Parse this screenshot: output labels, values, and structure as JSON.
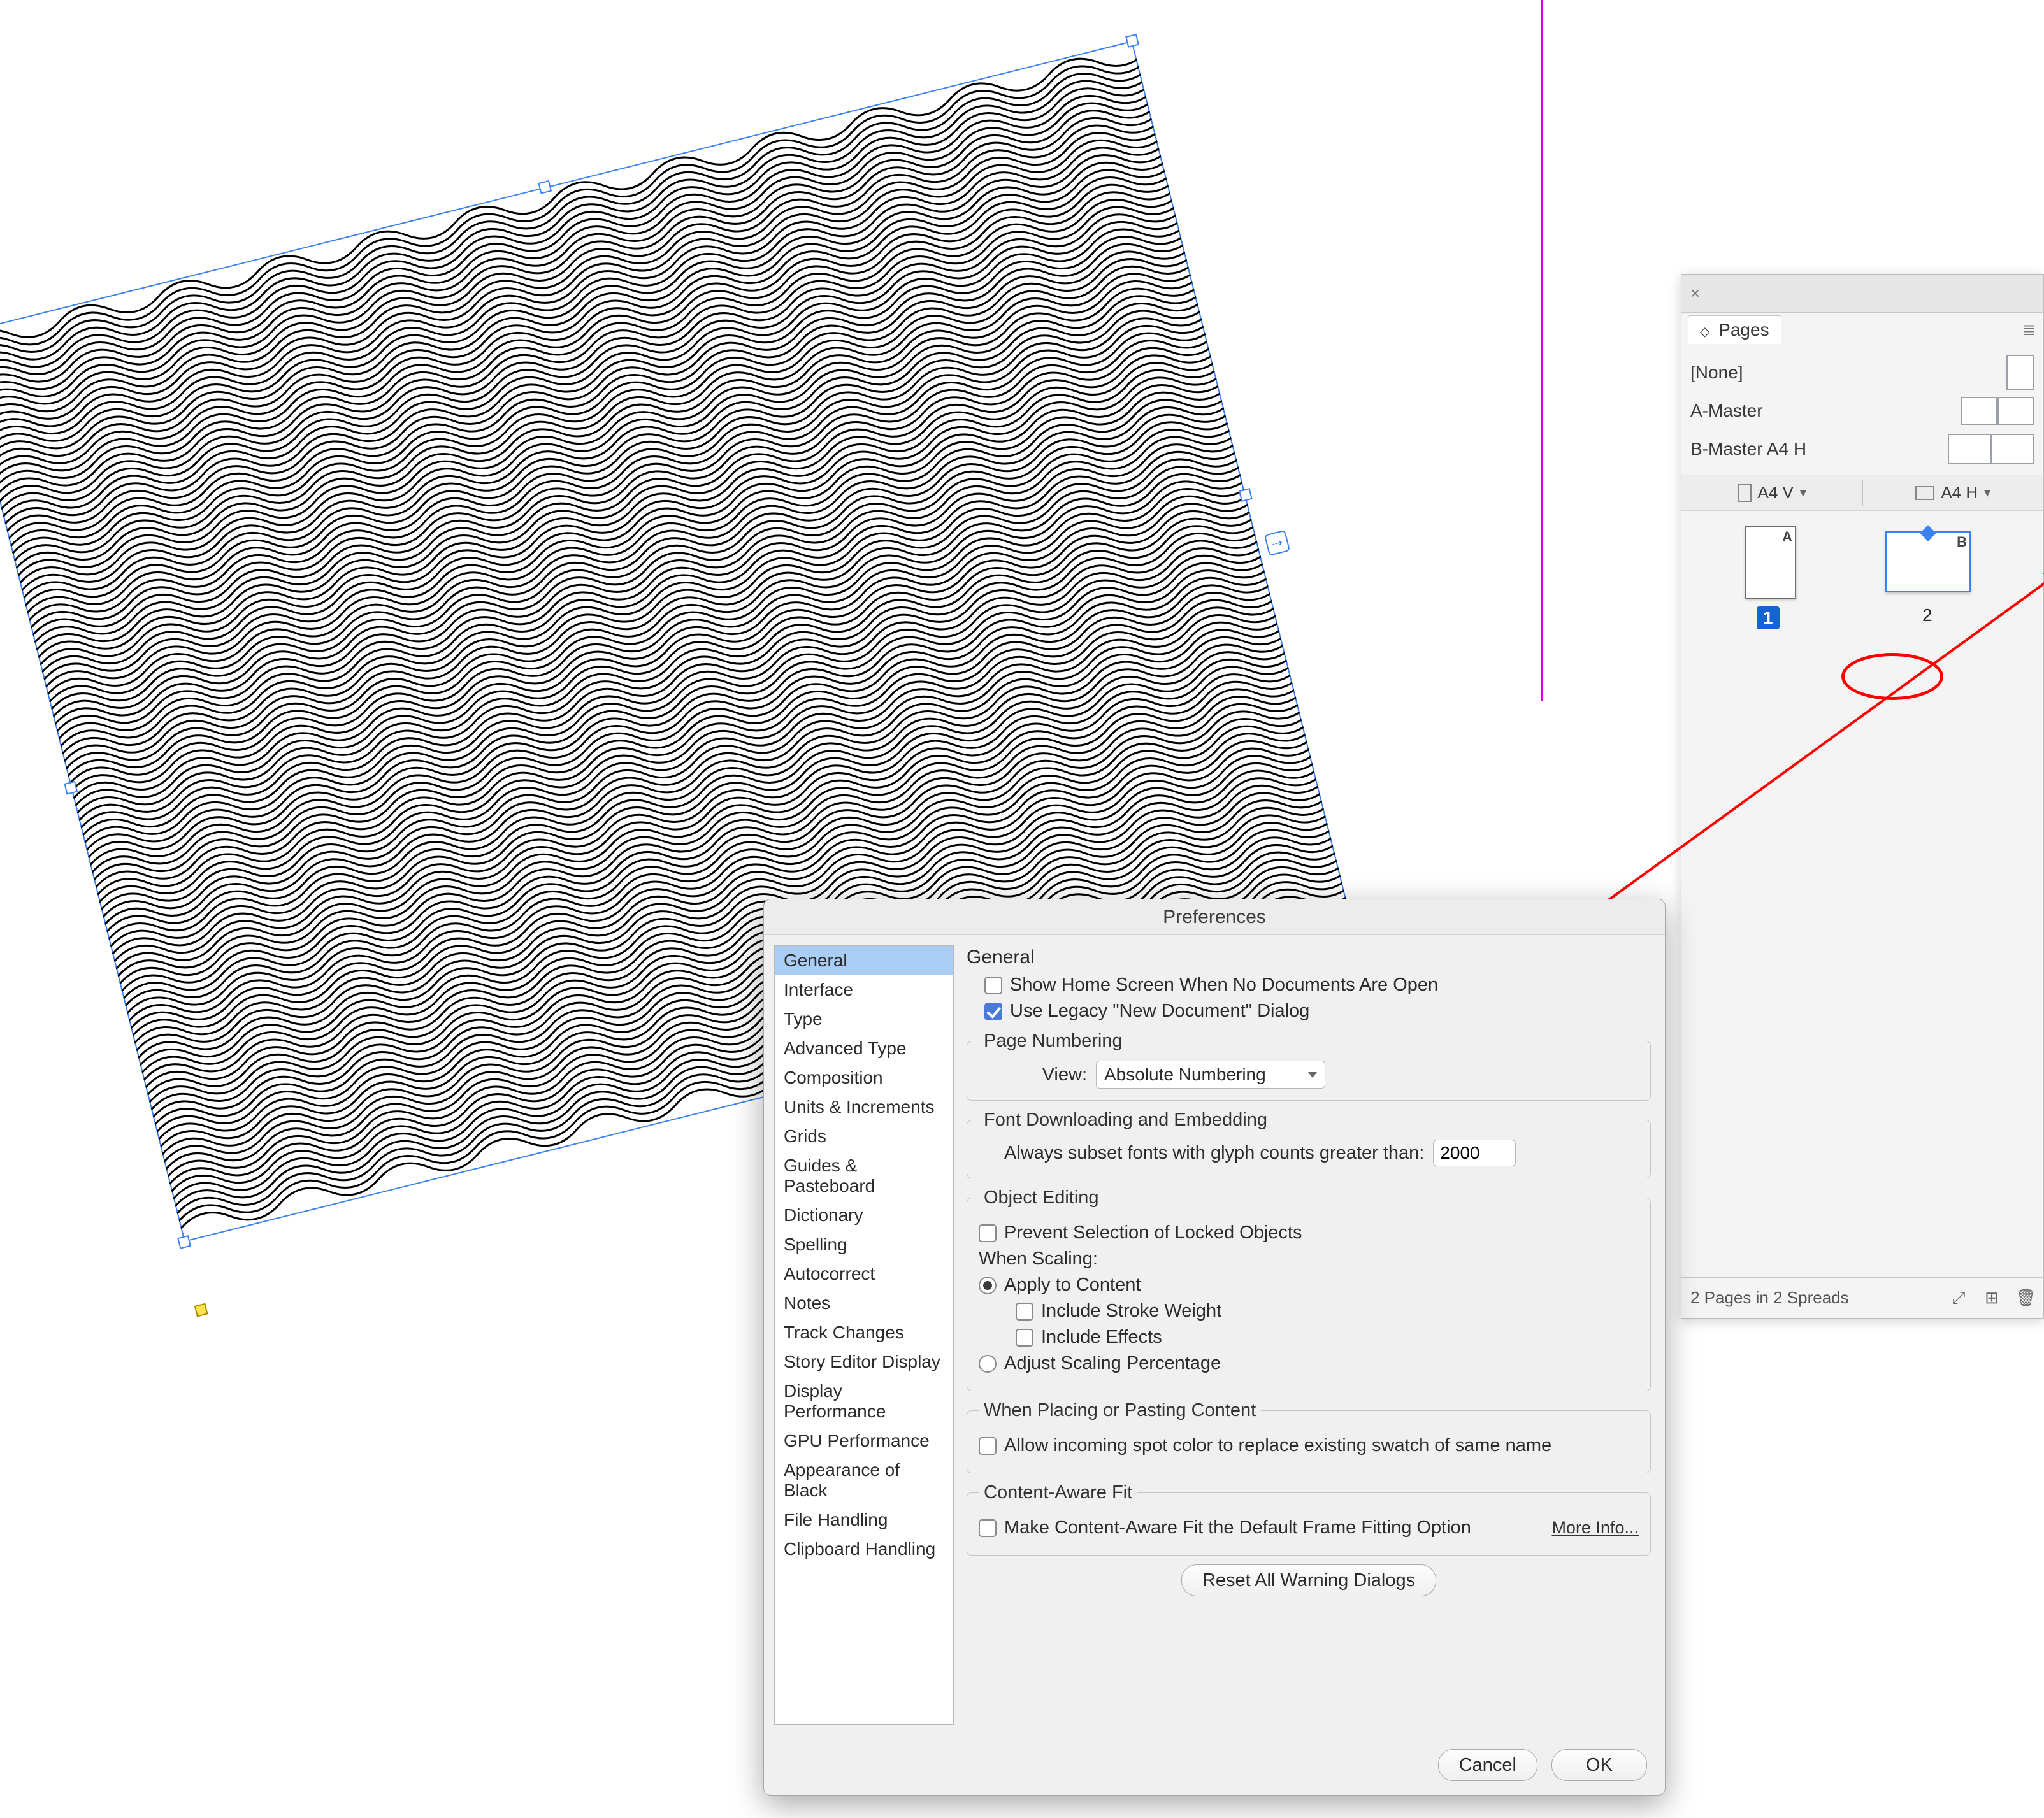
{
  "pages_panel": {
    "title": "Pages",
    "masters": [
      {
        "label": "[None]",
        "spread": "single"
      },
      {
        "label": "A-Master",
        "spread": "facing"
      },
      {
        "label": "B-Master A4 H",
        "spread": "facing-h"
      }
    ],
    "columns": [
      {
        "label": "A4 V"
      },
      {
        "label": "A4 H"
      }
    ],
    "thumbs": [
      {
        "letter": "A",
        "num": "1",
        "badge": true,
        "orient": "v"
      },
      {
        "letter": "B",
        "num": "2",
        "badge": false,
        "orient": "h"
      }
    ],
    "footer": "2 Pages in 2 Spreads"
  },
  "prefs": {
    "title": "Preferences",
    "categories": [
      "General",
      "Interface",
      "Type",
      "Advanced Type",
      "Composition",
      "Units & Increments",
      "Grids",
      "Guides & Pasteboard",
      "Dictionary",
      "Spelling",
      "Autocorrect",
      "Notes",
      "Track Changes",
      "Story Editor Display",
      "Display Performance",
      "GPU Performance",
      "Appearance of Black",
      "File Handling",
      "Clipboard Handling"
    ],
    "selected_category": "General",
    "heading": "General",
    "show_home": {
      "label": "Show Home Screen When No Documents Are Open",
      "checked": false
    },
    "legacy_dialog": {
      "label": "Use Legacy \"New Document\" Dialog",
      "checked": true
    },
    "page_numbering_group": "Page Numbering",
    "view_label": "View:",
    "view_value": "Absolute Numbering",
    "font_group": "Font Downloading and Embedding",
    "font_label": "Always subset fonts with glyph counts greater than:",
    "font_value": "2000",
    "object_editing_group": "Object Editing",
    "prevent_sel": {
      "label": "Prevent Selection of Locked Objects",
      "checked": false
    },
    "when_scaling": "When Scaling:",
    "apply_content": {
      "label": "Apply to Content",
      "selected": true
    },
    "include_stroke": {
      "label": "Include Stroke Weight",
      "checked": false
    },
    "include_effects": {
      "label": "Include Effects",
      "checked": false
    },
    "adjust_scaling": {
      "label": "Adjust Scaling Percentage",
      "selected": false
    },
    "placing_group": "When Placing or Pasting Content",
    "allow_spot": {
      "label": "Allow incoming spot color to replace existing swatch of same name",
      "checked": false
    },
    "caf_group": "Content-Aware Fit",
    "caf_check": {
      "label": "Make Content-Aware Fit the Default Frame Fitting Option",
      "checked": false
    },
    "more_info": "More Info...",
    "reset_btn": "Reset All Warning Dialogs",
    "cancel": "Cancel",
    "ok": "OK"
  }
}
